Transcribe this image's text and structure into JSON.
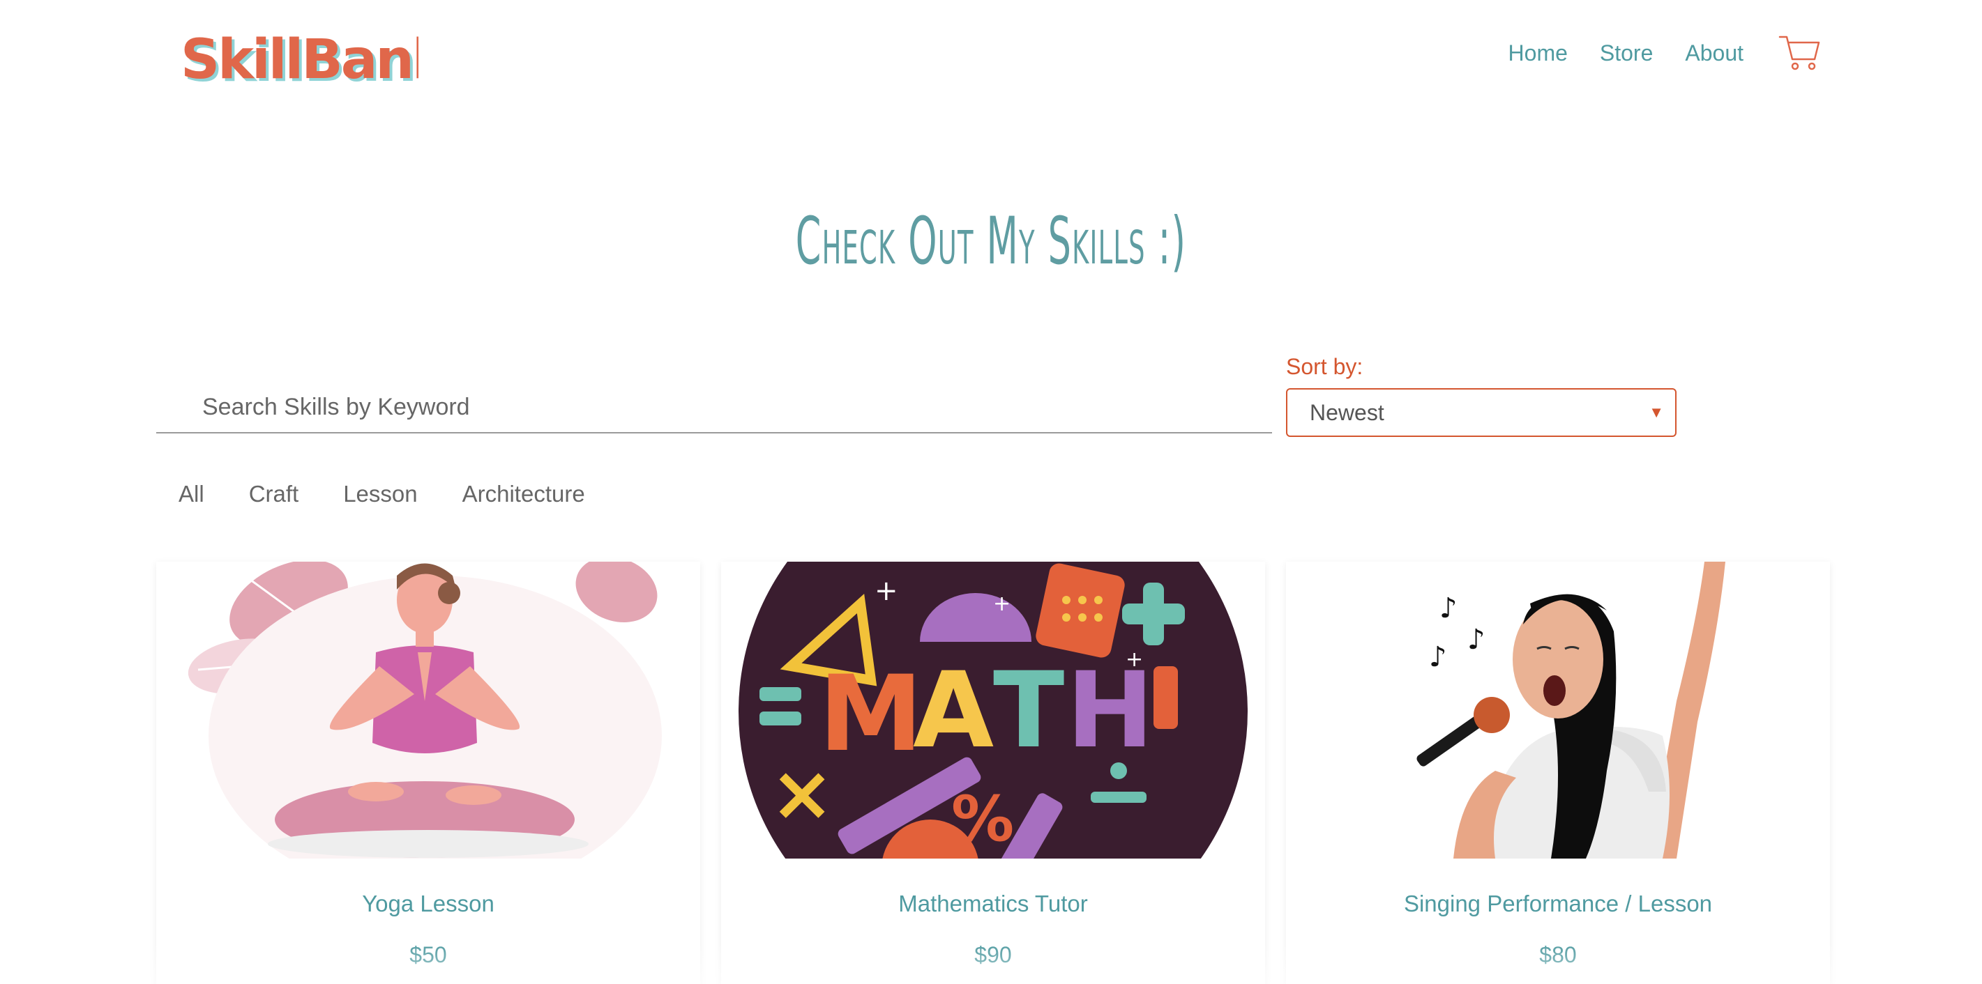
{
  "brand": {
    "logo_text": "SkillBank"
  },
  "nav": {
    "home": "Home",
    "store": "Store",
    "about": "About",
    "cart_icon": "shopping-cart-icon"
  },
  "page": {
    "headline": "Check Out My Skills :)"
  },
  "search": {
    "placeholder": "Search Skills by Keyword",
    "value": ""
  },
  "sort": {
    "label": "Sort by:",
    "selected": "Newest"
  },
  "filters": [
    "All",
    "Craft",
    "Lesson",
    "Architecture"
  ],
  "products": [
    {
      "name": "Yoga Lesson",
      "price": "$50",
      "image": "yoga-illustration"
    },
    {
      "name": "Mathematics Tutor",
      "price": "$90",
      "image": "math-illustration"
    },
    {
      "name": "Singing Performance / Lesson",
      "price": "$80",
      "image": "singer-illustration"
    }
  ],
  "colors": {
    "accent_teal": "#4f9aa0",
    "accent_orange": "#d4562f",
    "logo_orange": "#e0674a"
  }
}
